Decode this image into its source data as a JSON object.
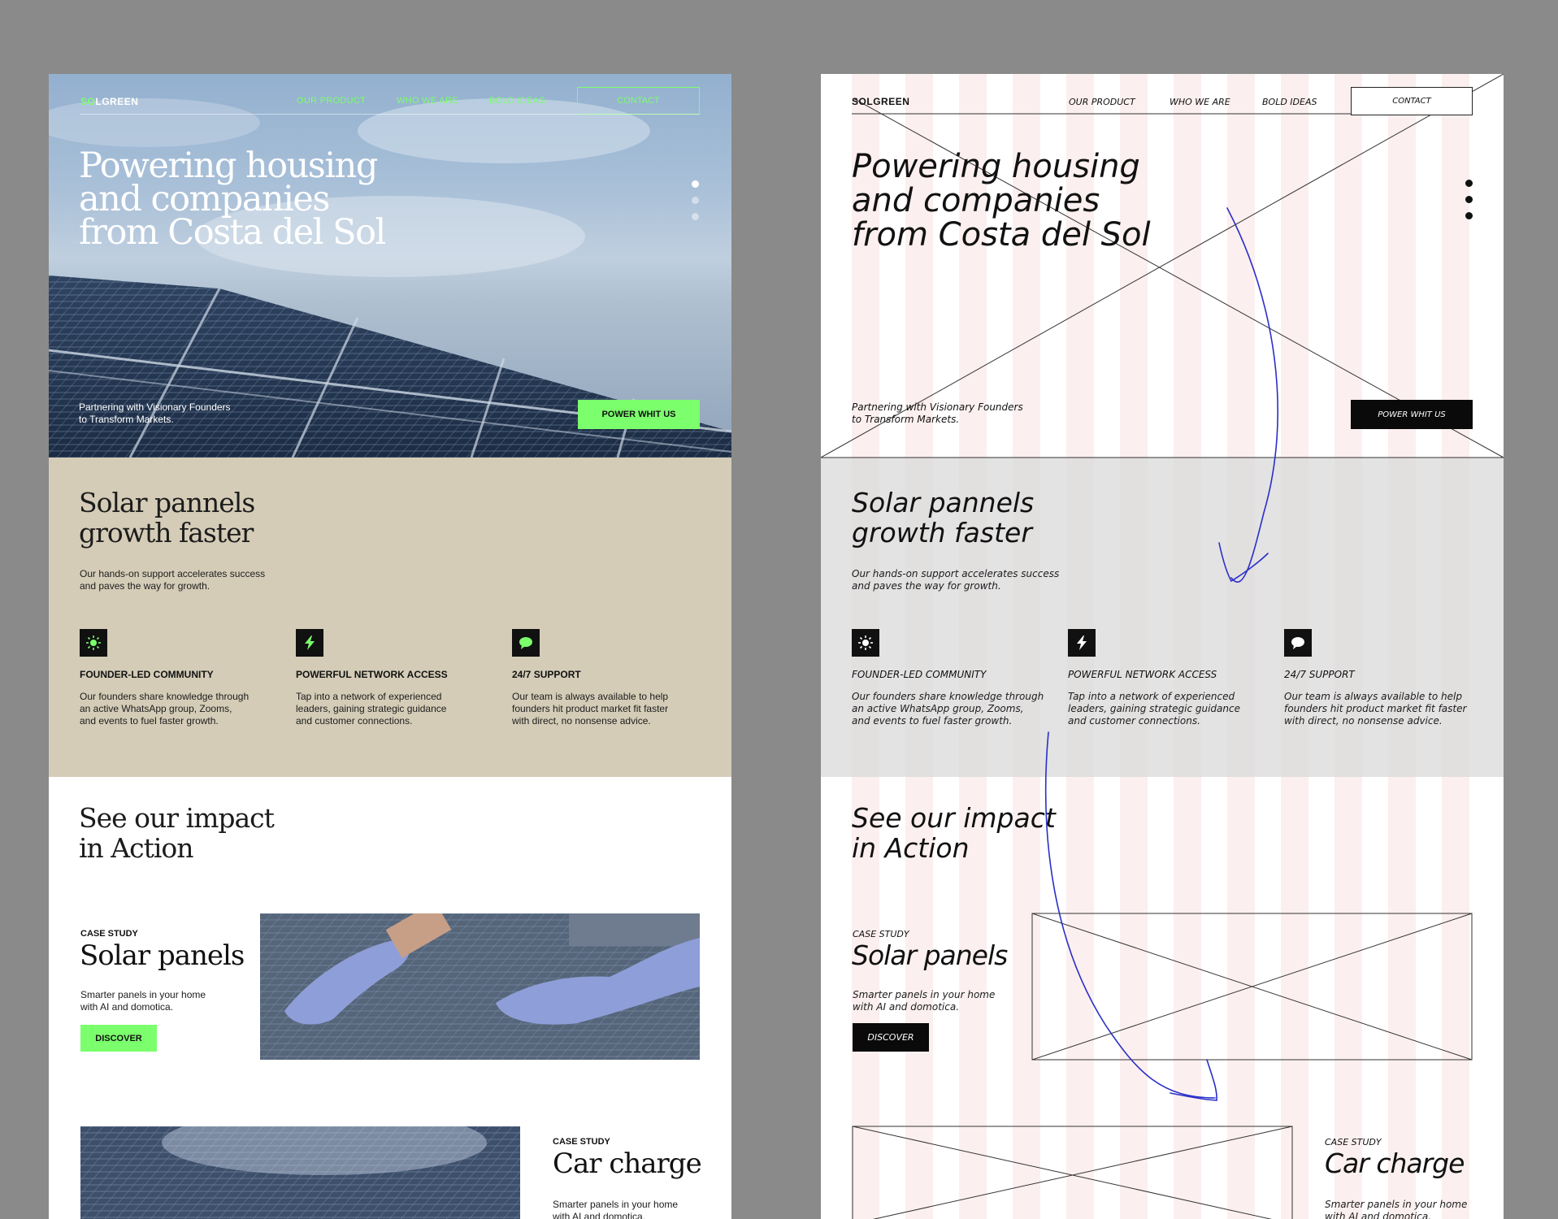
{
  "brand": {
    "logo_lead": "S",
    "logo_sun": "O",
    "logo_rest": "LGREEN",
    "accent": "#7bff6c"
  },
  "nav": {
    "items": [
      "OUR PRODUCT",
      "WHO WE ARE",
      "BOLD IDEAS"
    ],
    "contact": "CONTACT"
  },
  "hero": {
    "title_lines": [
      "Powering housing",
      "and companies",
      "from Costa del Sol"
    ],
    "tagline_lines": [
      "Partnering with Visionary Founders",
      "to Transform Markets."
    ],
    "cta": "POWER WHIT US",
    "slides": 3,
    "active_slide": 1
  },
  "features": {
    "heading_lines": [
      "Solar pannels",
      "growth faster"
    ],
    "intro_lines": [
      "Our hands-on support accelerates success",
      "and paves the way for growth."
    ],
    "items": [
      {
        "icon": "sun-icon",
        "title": "FOUNDER-LED COMMUNITY",
        "lines": [
          "Our founders share knowledge through",
          "an active WhatsApp group, Zooms,",
          "and events to fuel faster growth."
        ]
      },
      {
        "icon": "lightning-icon",
        "title": "POWERFUL NETWORK ACCESS",
        "lines": [
          "Tap into a network of experienced",
          "leaders, gaining strategic guidance",
          "and customer connections."
        ]
      },
      {
        "icon": "chat-icon",
        "title": "24/7 SUPPORT",
        "lines": [
          "Our team is always available to help",
          "founders hit product market fit faster",
          "with direct, no nonsense advice."
        ]
      }
    ]
  },
  "impact": {
    "heading_lines": [
      "See our impact",
      "in Action"
    ],
    "cases": [
      {
        "label": "CASE STUDY",
        "title": "Solar panels",
        "desc_lines": [
          "Smarter panels in your home",
          "with AI and domotica."
        ],
        "cta": "DISCOVER"
      },
      {
        "label": "CASE STUDY",
        "title": "Car charge",
        "desc_lines": [
          "Smarter panels in your home",
          "with AI and domotica."
        ]
      }
    ]
  },
  "wireframe": {
    "nav_items": [
      "Our product",
      "Who we are",
      "Bold ideas"
    ],
    "contact": "CONTACT",
    "feature_titles": [
      "Founder-led community",
      "Powerful network access",
      "24/7 support"
    ],
    "hero_cta": "POWER WHIT US",
    "case_label": "CASE STUDY",
    "discover": "DISCOVER"
  },
  "colors": {
    "sand": "#d4ccb7",
    "wire_pink": "#fcefef",
    "wire_grey": "#dadada",
    "arrow_blue": "#2a2fc9"
  }
}
